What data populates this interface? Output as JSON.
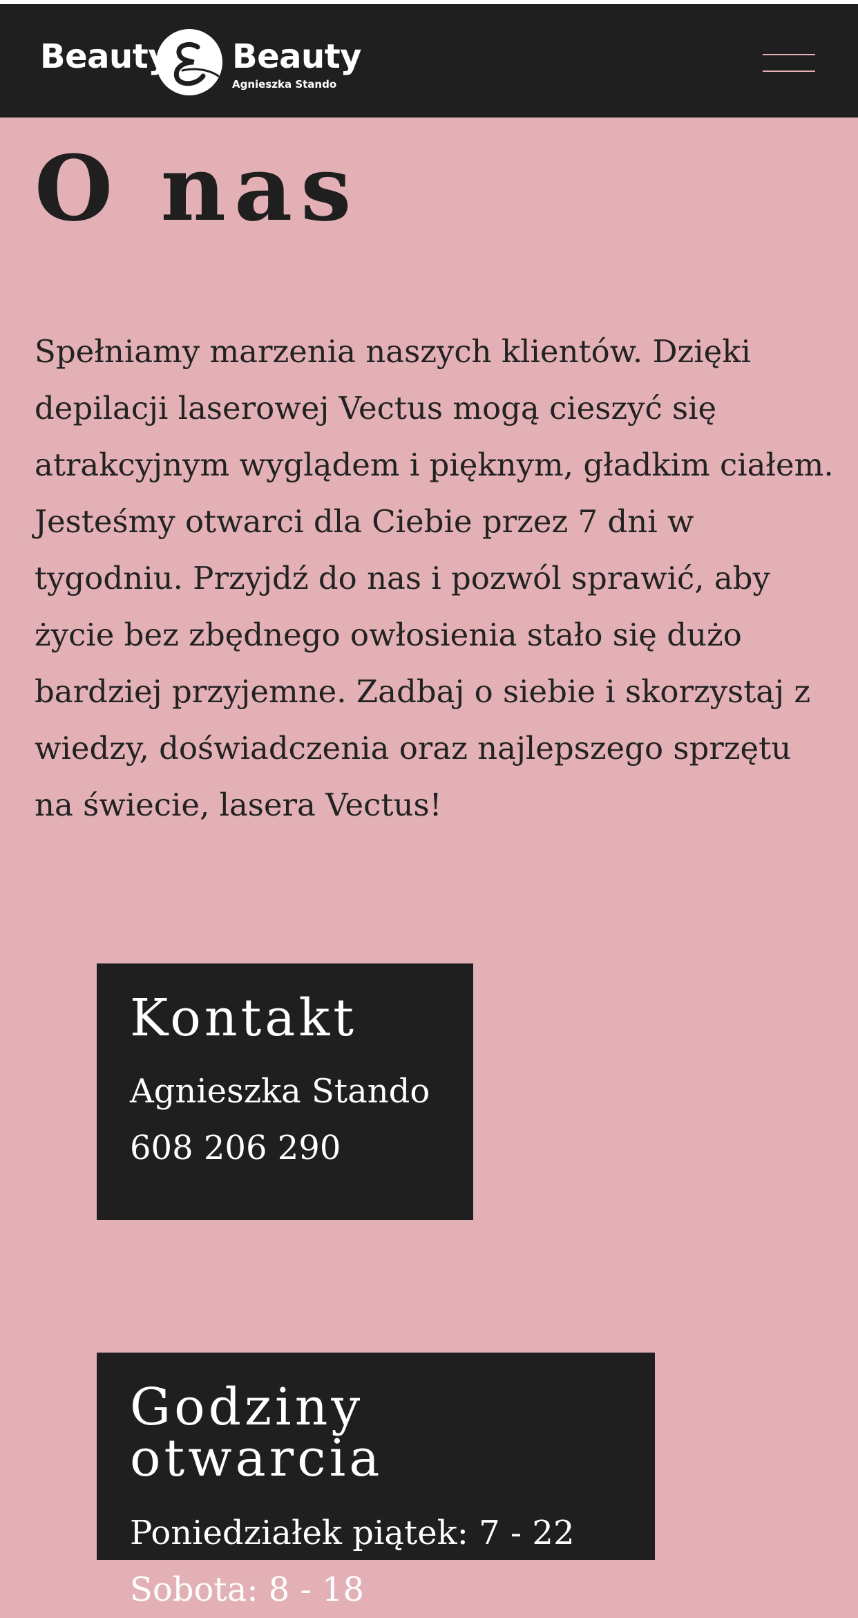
{
  "header": {
    "logo": {
      "word_left": "Beauty",
      "word_right": "Beauty",
      "subtitle": "Agnieszka Stando",
      "mark_icon": "ampersand-icon"
    },
    "menu_icon": "hamburger-icon"
  },
  "page": {
    "title": "O nas",
    "intro": "Spełniamy marzenia naszych klientów. Dzięki depilacji laserowej Vectus mogą cieszyć się atrakcyjnym wyglądem i pięknym, gładkim ciałem. Jesteśmy otwarci dla Ciebie przez 7 dni w tygodniu. Przyjdź do nas i pozwól sprawić, aby życie bez zbędnego owłosienia stało się dużo bardziej przyjemne. Zadbaj o siebie i skorzystaj z wiedzy, doświadczenia oraz najlepszego sprzętu na świecie, lasera Vectus!"
  },
  "contact": {
    "title": "Kontakt",
    "name": "Agnieszka Stando",
    "phone": "608 206 290"
  },
  "hours": {
    "title": "Godziny otwarcia",
    "weekdays": "Poniedziałek piątek: 7 - 22",
    "saturday": "Sobota: 8 - 18"
  },
  "colors": {
    "background": "#e3b0b5",
    "dark": "#1f1f1f",
    "text": "#222222",
    "light": "#ffffff",
    "accent": "#e3b0b5"
  }
}
